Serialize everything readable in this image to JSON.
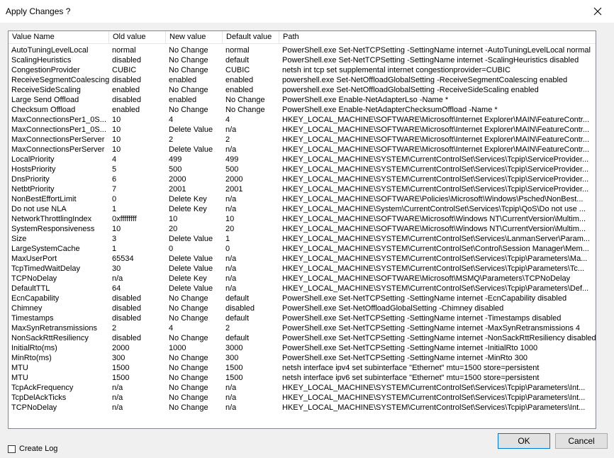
{
  "window": {
    "title": "Apply Changes ?"
  },
  "columns": [
    "Value Name",
    "Old value",
    "New value",
    "Default value",
    "Path"
  ],
  "rows": [
    [
      "AutoTuningLevelLocal",
      "normal",
      "No Change",
      "normal",
      "PowerShell.exe Set-NetTCPSetting -SettingName internet -AutoTuningLevelLocal normal"
    ],
    [
      "ScalingHeuristics",
      "disabled",
      "No Change",
      "default",
      "PowerShell.exe Set-NetTCPSetting -SettingName internet -ScalingHeuristics disabled"
    ],
    [
      "CongestionProvider",
      "CUBIC",
      "No Change",
      "CUBIC",
      "netsh int tcp set supplemental internet congestionprovider=CUBIC"
    ],
    [
      "ReceiveSegmentCoalescing",
      "disabled",
      "enabled",
      "enabled",
      "powershell.exe Set-NetOffloadGlobalSetting -ReceiveSegmentCoalescing enabled"
    ],
    [
      "ReceiveSideScaling",
      "enabled",
      "No Change",
      "enabled",
      "powershell.exe Set-NetOffloadGlobalSetting -ReceiveSideScaling enabled"
    ],
    [
      "Large Send Offload",
      "disabled",
      "enabled",
      "No Change",
      "PowerShell.exe Enable-NetAdapterLso -Name *"
    ],
    [
      "Checksum Offload",
      "enabled",
      "No Change",
      "No Change",
      "PowerShell.exe Enable-NetAdapterChecksumOffload -Name *"
    ],
    [
      "MaxConnectionsPer1_0S...",
      "10",
      "4",
      "4",
      "HKEY_LOCAL_MACHINE\\SOFTWARE\\Microsoft\\Internet Explorer\\MAIN\\FeatureContr..."
    ],
    [
      "MaxConnectionsPer1_0S...",
      "10",
      "Delete Value",
      "n/a",
      "HKEY_LOCAL_MACHINE\\SOFTWARE\\Microsoft\\Internet Explorer\\MAIN\\FeatureContr..."
    ],
    [
      "MaxConnectionsPerServer",
      "10",
      "2",
      "2",
      "HKEY_LOCAL_MACHINE\\SOFTWARE\\Microsoft\\Internet Explorer\\MAIN\\FeatureContr..."
    ],
    [
      "MaxConnectionsPerServer",
      "10",
      "Delete Value",
      "n/a",
      "HKEY_LOCAL_MACHINE\\SOFTWARE\\Microsoft\\Internet Explorer\\MAIN\\FeatureContr..."
    ],
    [
      "LocalPriority",
      "4",
      "499",
      "499",
      "HKEY_LOCAL_MACHINE\\SYSTEM\\CurrentControlSet\\Services\\Tcpip\\ServiceProvider..."
    ],
    [
      "HostsPriority",
      "5",
      "500",
      "500",
      "HKEY_LOCAL_MACHINE\\SYSTEM\\CurrentControlSet\\Services\\Tcpip\\ServiceProvider..."
    ],
    [
      "DnsPriority",
      "6",
      "2000",
      "2000",
      "HKEY_LOCAL_MACHINE\\SYSTEM\\CurrentControlSet\\Services\\Tcpip\\ServiceProvider..."
    ],
    [
      "NetbtPriority",
      "7",
      "2001",
      "2001",
      "HKEY_LOCAL_MACHINE\\SYSTEM\\CurrentControlSet\\Services\\Tcpip\\ServiceProvider..."
    ],
    [
      "NonBestEffortLimit",
      "0",
      "Delete  Key",
      "n/a",
      "HKEY_LOCAL_MACHINE\\SOFTWARE\\Policies\\Microsoft\\Windows\\Psched\\NonBest..."
    ],
    [
      "Do not use NLA",
      "1",
      "Delete  Key",
      "n/a",
      "HKEY_LOCAL_MACHINE\\System\\CurrentControlSet\\Services\\Tcpip\\QoS\\Do not use ..."
    ],
    [
      "NetworkThrottlingIndex",
      "0xffffffff",
      "10",
      "10",
      "HKEY_LOCAL_MACHINE\\SOFTWARE\\Microsoft\\Windows NT\\CurrentVersion\\Multim..."
    ],
    [
      "SystemResponsiveness",
      "10",
      "20",
      "20",
      "HKEY_LOCAL_MACHINE\\SOFTWARE\\Microsoft\\Windows NT\\CurrentVersion\\Multim..."
    ],
    [
      "Size",
      "3",
      "Delete Value",
      "1",
      "HKEY_LOCAL_MACHINE\\SYSTEM\\CurrentControlSet\\Services\\LanmanServer\\Param..."
    ],
    [
      "LargeSystemCache",
      "1",
      "0",
      "0",
      "HKEY_LOCAL_MACHINE\\SYSTEM\\CurrentControlSet\\Control\\Session Manager\\Mem..."
    ],
    [
      "MaxUserPort",
      "65534",
      "Delete Value",
      "n/a",
      "HKEY_LOCAL_MACHINE\\SYSTEM\\CurrentControlSet\\Services\\Tcpip\\Parameters\\Ma..."
    ],
    [
      "TcpTimedWaitDelay",
      "30",
      "Delete Value",
      "n/a",
      "HKEY_LOCAL_MACHINE\\SYSTEM\\CurrentControlSet\\Services\\Tcpip\\Parameters\\Tc..."
    ],
    [
      "TCPNoDelay",
      "n/a",
      "Delete  Key",
      "n/a",
      "HKEY_LOCAL_MACHINE\\SOFTWARE\\Microsoft\\MSMQ\\Parameters\\TCPNoDelay"
    ],
    [
      "DefaultTTL",
      "64",
      "Delete Value",
      "n/a",
      "HKEY_LOCAL_MACHINE\\SYSTEM\\CurrentControlSet\\Services\\Tcpip\\Parameters\\Def..."
    ],
    [
      "EcnCapability",
      "disabled",
      "No Change",
      "default",
      "PowerShell.exe Set-NetTCPSetting -SettingName internet -EcnCapability disabled"
    ],
    [
      "Chimney",
      "disabled",
      "No Change",
      "disabled",
      "PowerShell.exe Set-NetOffloadGlobalSetting -Chimney disabled"
    ],
    [
      "Timestamps",
      "disabled",
      "No Change",
      "default",
      "PowerShell.exe Set-NetTCPSetting -SettingName internet -Timestamps disabled"
    ],
    [
      "MaxSynRetransmissions",
      "2",
      "4",
      "2",
      "PowerShell.exe Set-NetTCPSetting -SettingName internet -MaxSynRetransmissions 4"
    ],
    [
      "NonSackRttResiliency",
      "disabled",
      "No Change",
      "default",
      "PowerShell.exe Set-NetTCPSetting -SettingName internet -NonSackRttResiliency disabled"
    ],
    [
      "InitialRto(ms)",
      "2000",
      "1000",
      "3000",
      "PowerShell.exe Set-NetTCPSetting -SettingName internet -InitialRto 1000"
    ],
    [
      "MinRto(ms)",
      "300",
      "No Change",
      "300",
      "PowerShell.exe Set-NetTCPSetting -SettingName internet -MinRto 300"
    ],
    [
      "MTU",
      "1500",
      "No Change",
      "1500",
      "netsh interface ipv4 set subinterface \"Ethernet\" mtu=1500 store=persistent"
    ],
    [
      "MTU",
      "1500",
      "No Change",
      "1500",
      "netsh interface ipv6 set subinterface \"Ethernet\" mtu=1500 store=persistent"
    ],
    [
      "TcpAckFrequency",
      "n/a",
      "No Change",
      "n/a",
      "HKEY_LOCAL_MACHINE\\SYSTEM\\CurrentControlSet\\Services\\Tcpip\\Parameters\\Int..."
    ],
    [
      "TcpDelAckTicks",
      "n/a",
      "No Change",
      "n/a",
      "HKEY_LOCAL_MACHINE\\SYSTEM\\CurrentControlSet\\Services\\Tcpip\\Parameters\\Int..."
    ],
    [
      "TCPNoDelay",
      "n/a",
      "No Change",
      "n/a",
      "HKEY_LOCAL_MACHINE\\SYSTEM\\CurrentControlSet\\Services\\Tcpip\\Parameters\\Int..."
    ]
  ],
  "footer": {
    "create_log_label": "Create Log",
    "create_log_checked": false,
    "ok_label": "OK",
    "cancel_label": "Cancel"
  },
  "icons": {
    "close": "close-icon"
  }
}
